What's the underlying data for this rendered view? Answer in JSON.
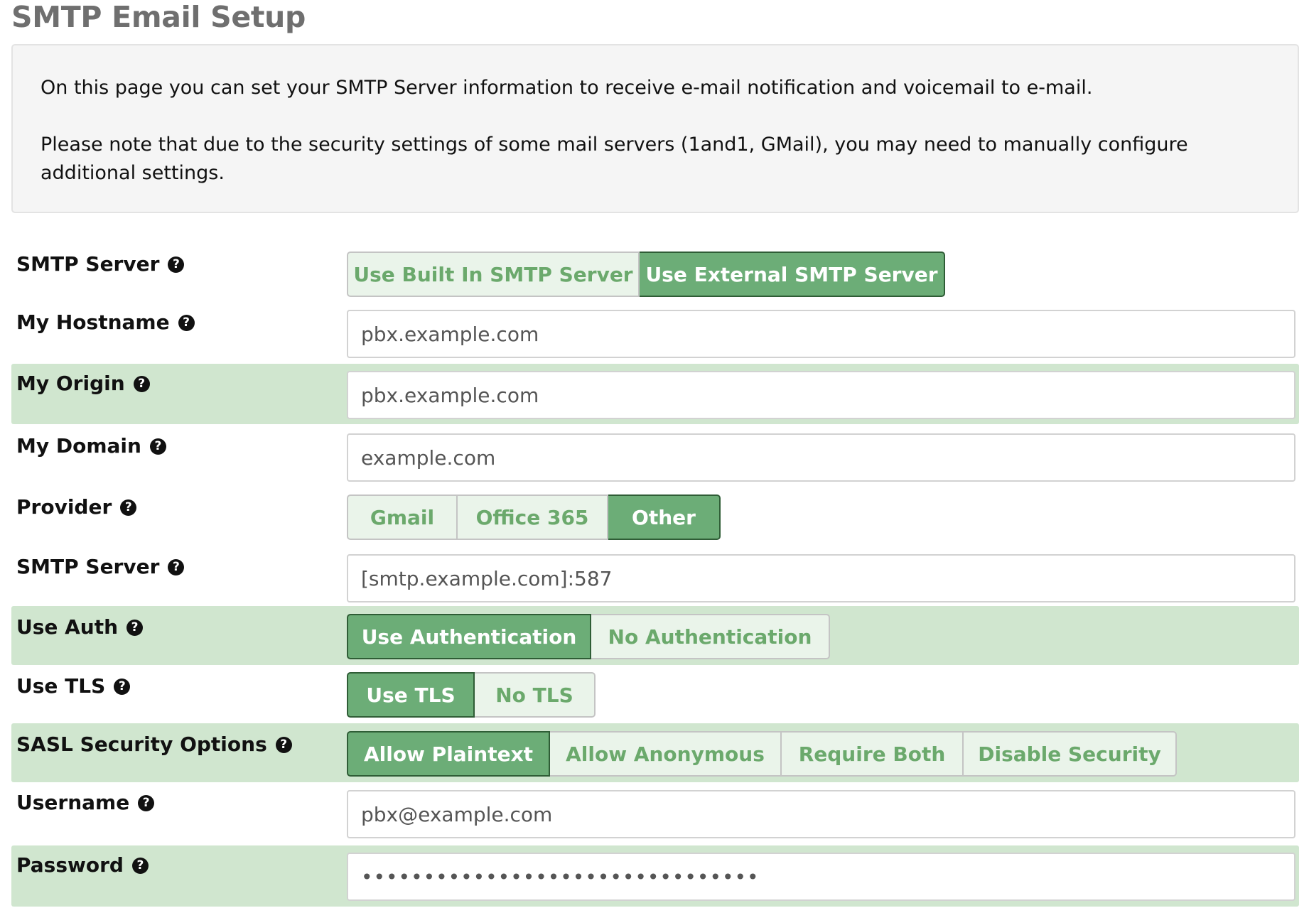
{
  "page": {
    "title": "SMTP Email Setup"
  },
  "info": {
    "paragraph1": "On this page you can set your SMTP Server information to receive e-mail notification and voicemail to e-mail.",
    "paragraph2": "Please note that due to the security settings of some mail servers (1and1, GMail), you may need to manually configure additional settings."
  },
  "help_icon_glyph": "?",
  "colors": {
    "active_button": "#6cad77",
    "inactive_button": "#eaf4ea",
    "inactive_text": "#6ba96c",
    "row_highlight": "#d0e6cf",
    "title_gray": "#6f6f6f"
  },
  "form": {
    "smtp_server_mode": {
      "label": "SMTP Server",
      "options": [
        "Use Built In SMTP Server",
        "Use External SMTP Server"
      ],
      "selected": "Use External SMTP Server"
    },
    "hostname": {
      "label": "My Hostname",
      "value": "pbx.example.com"
    },
    "origin": {
      "label": "My Origin",
      "value": "pbx.example.com"
    },
    "domain": {
      "label": "My Domain",
      "value": "example.com"
    },
    "provider": {
      "label": "Provider",
      "options": [
        "Gmail",
        "Office 365",
        "Other"
      ],
      "selected": "Other"
    },
    "smtp_server": {
      "label": "SMTP Server",
      "value": "[smtp.example.com]:587"
    },
    "use_auth": {
      "label": "Use Auth",
      "options": [
        "Use Authentication",
        "No Authentication"
      ],
      "selected": "Use Authentication"
    },
    "use_tls": {
      "label": "Use TLS",
      "options": [
        "Use TLS",
        "No TLS"
      ],
      "selected": "Use TLS"
    },
    "sasl": {
      "label": "SASL Security Options",
      "options": [
        "Allow Plaintext",
        "Allow Anonymous",
        "Require Both",
        "Disable Security"
      ],
      "selected": "Allow Plaintext"
    },
    "username": {
      "label": "Username",
      "value": "pbx@example.com"
    },
    "password": {
      "label": "Password",
      "value": "••••••••••••••••••••••••••••••••"
    }
  }
}
